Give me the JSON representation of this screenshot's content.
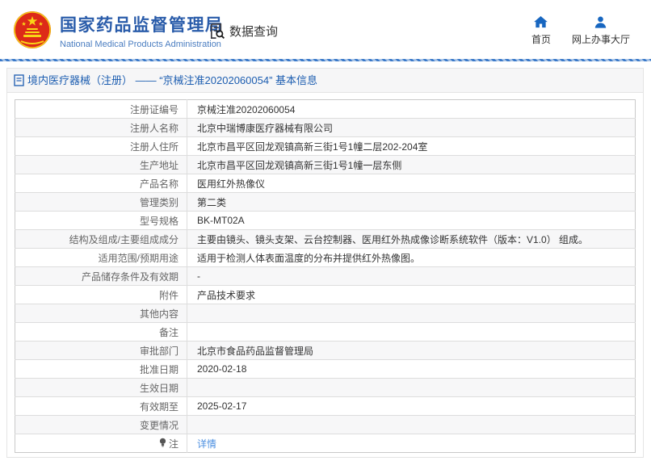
{
  "header": {
    "org_title": "国家药品监督管理局",
    "org_subtitle": "National Medical Products Administration",
    "data_query_label": "数据查询",
    "nav": {
      "home_label": "首页",
      "service_hall_label": "网上办事大厅"
    }
  },
  "breadcrumb": {
    "text": "境内医疗器械（注册） —— “京械注准20202060054” 基本信息"
  },
  "table": {
    "rows": [
      {
        "label": "注册证编号",
        "value": "京械注准20202060054"
      },
      {
        "label": "注册人名称",
        "value": "北京中瑞博康医疗器械有限公司"
      },
      {
        "label": "注册人住所",
        "value": "北京市昌平区回龙观镇高新三街1号1幢二层202-204室"
      },
      {
        "label": "生产地址",
        "value": "北京市昌平区回龙观镇高新三街1号1幢一层东侧"
      },
      {
        "label": "产品名称",
        "value": "医用红外热像仪"
      },
      {
        "label": "管理类别",
        "value": "第二类"
      },
      {
        "label": "型号规格",
        "value": "BK-MT02A"
      },
      {
        "label": "结构及组成/主要组成成分",
        "value": "主要由镜头、镜头支架、云台控制器、医用红外热成像诊断系统软件（版本：V1.0） 组成。"
      },
      {
        "label": "适用范围/预期用途",
        "value": "适用于检测人体表面温度的分布并提供红外热像图。"
      },
      {
        "label": "产品储存条件及有效期",
        "value": "-"
      },
      {
        "label": "附件",
        "value": "产品技术要求"
      },
      {
        "label": "其他内容",
        "value": ""
      },
      {
        "label": "备注",
        "value": ""
      },
      {
        "label": "审批部门",
        "value": "北京市食品药品监督管理局"
      },
      {
        "label": "批准日期",
        "value": "2020-02-18"
      },
      {
        "label": "生效日期",
        "value": ""
      },
      {
        "label": "有效期至",
        "value": "2025-02-17"
      },
      {
        "label": "变更情况",
        "value": ""
      },
      {
        "label": "注",
        "value": "详情",
        "value_is_link": true,
        "label_icon": "bulb-icon"
      }
    ]
  },
  "icons": [
    "national-emblem-icon",
    "data-query-icon",
    "home-icon",
    "person-icon",
    "document-icon",
    "bulb-icon"
  ],
  "colors": {
    "brand_blue": "#2a5caa",
    "nav_icon_blue": "#1766c0",
    "breadcrumb_blue": "#1c5db0",
    "link_blue": "#4c8fe0",
    "stripe_gray": "#f7f7f8"
  }
}
